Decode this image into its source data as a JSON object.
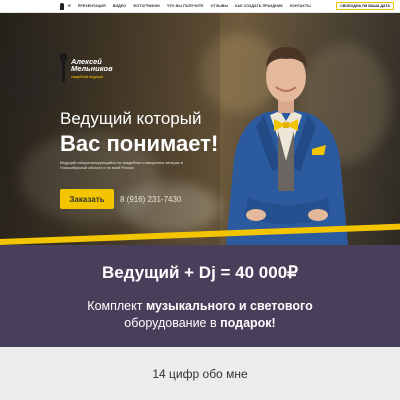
{
  "nav": {
    "items": [
      "Я",
      "ПРЕЗЕНТАЦИЯ",
      "ВИДЕО",
      "ФОТОГРАФИИ",
      "ЧТО ВЫ ПОЛУЧИТЕ",
      "ОТЗЫВЫ",
      "КАК СОЗДАТЬ ПРАЗДНИК",
      "КОНТАКТЫ"
    ],
    "cta": "СВОБОДНА ЛИ ВАША ДАТА"
  },
  "hero": {
    "brand_name_1": "Алексей",
    "brand_name_2": "Мельников",
    "brand_sub": "свадебный ведущий",
    "headline1": "Ведущий который",
    "headline2": "Вас понимает!",
    "tagline": "Ведущий специализирующийся на свадебных и выпускных вечерах в Новосибирской области и по всей России",
    "order_button": "Заказать",
    "phone": "8 (916) 231-7430"
  },
  "band": {
    "title": "Ведущий + Dj = 40 000₽",
    "line1_a": "Комплект ",
    "line1_b": "музыкального и светового",
    "line2_a": "оборудование в ",
    "line2_b": "подарок!"
  },
  "section": {
    "title": "14 цифр обо мне"
  },
  "colors": {
    "accent": "#f2c500",
    "band": "#4a3f5a",
    "suit": "#2b5a9e"
  }
}
